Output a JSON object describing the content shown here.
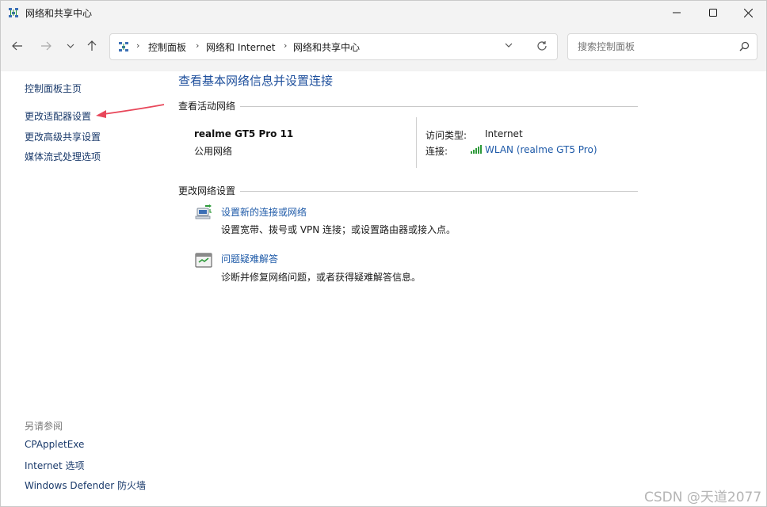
{
  "window": {
    "title": "网络和共享中心"
  },
  "address_bar": {
    "crumbs": [
      "控制面板",
      "网络和 Internet",
      "网络和共享中心"
    ]
  },
  "search": {
    "placeholder": "搜索控制面板"
  },
  "left_nav": {
    "items": [
      {
        "label": "控制面板主页"
      },
      {
        "label": "更改适配器设置"
      },
      {
        "label": "更改高级共享设置"
      },
      {
        "label": "媒体流式处理选项"
      }
    ],
    "see_also_title": "另请参阅",
    "see_also": [
      {
        "label": "CPAppletExe"
      },
      {
        "label": "Internet 选项"
      },
      {
        "label": "Windows Defender 防火墙"
      }
    ]
  },
  "main": {
    "title": "查看基本网络信息并设置连接",
    "active_section": "查看活动网络",
    "network": {
      "name": "realme GT5 Pro 11",
      "type": "公用网络",
      "access_type_label": "访问类型:",
      "access_type_value": "Internet",
      "connection_label": "连接:",
      "connection_value": "WLAN (realme GT5 Pro)"
    },
    "change_section": "更改网络设置",
    "tasks": [
      {
        "link": "设置新的连接或网络",
        "desc": "设置宽带、拨号或 VPN 连接；或设置路由器或接入点。"
      },
      {
        "link": "问题疑难解答",
        "desc": "诊断并修复网络问题，或者获得疑难解答信息。"
      }
    ]
  },
  "watermark": "CSDN @天道2077",
  "colors": {
    "link_blue": "#1e5aa8",
    "title_blue": "#1e4f9c",
    "annotation_red": "#e8475a",
    "signal_green": "#2e9a3a"
  },
  "icons": [
    "network-center-icon",
    "minimize-icon",
    "maximize-icon",
    "close-icon",
    "back-arrow-icon",
    "forward-arrow-icon",
    "chevron-down-icon",
    "up-arrow-icon",
    "chevron-right-icon",
    "refresh-icon",
    "search-icon",
    "wifi-signal-icon",
    "new-connection-icon",
    "troubleshoot-icon"
  ]
}
